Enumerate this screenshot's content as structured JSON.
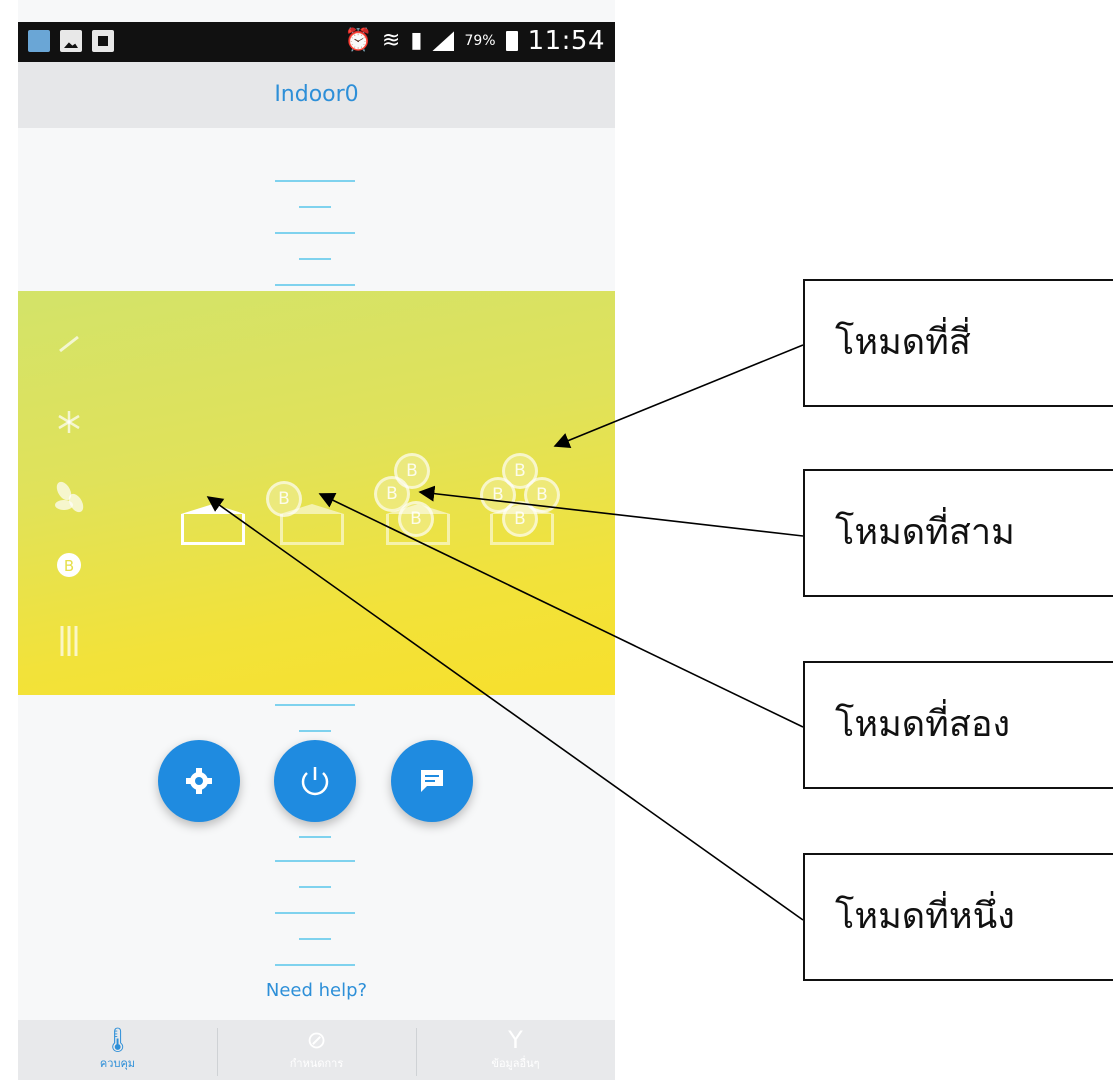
{
  "status_bar": {
    "battery": "79%",
    "time": "11:54"
  },
  "app": {
    "title": "Indoor0",
    "need_help": "Need help?"
  },
  "modes": [
    {
      "name": "mode-1",
      "coins": 0,
      "active": true
    },
    {
      "name": "mode-2",
      "coins": 1,
      "active": false
    },
    {
      "name": "mode-3",
      "coins": 3,
      "active": false
    },
    {
      "name": "mode-4",
      "coins": 4,
      "active": false
    }
  ],
  "coin_letter": "B",
  "side_icons": [
    "dry-icon",
    "snowflake-icon",
    "fan-icon",
    "boost-icon",
    "heat-icon"
  ],
  "fabs": [
    "settings-icon",
    "power-icon",
    "message-icon"
  ],
  "bottom_nav": [
    {
      "icon": "thermometer-icon",
      "label": "ควบคุม",
      "active": true
    },
    {
      "icon": "compass-icon",
      "label": "กำหนดการ",
      "active": false
    },
    {
      "icon": "tools-icon",
      "label": "ข้อมูลอื่นๆ",
      "active": false
    }
  ],
  "callouts": {
    "mode4": "โหมดที่สี่",
    "mode3": "โหมดที่สาม",
    "mode2": "โหมดที่สอง",
    "mode1": "โหมดที่หนึ่ง"
  },
  "colors": {
    "accent": "#1f8be0",
    "panel_top": "#d3e369",
    "panel_bottom": "#f7e02c"
  }
}
